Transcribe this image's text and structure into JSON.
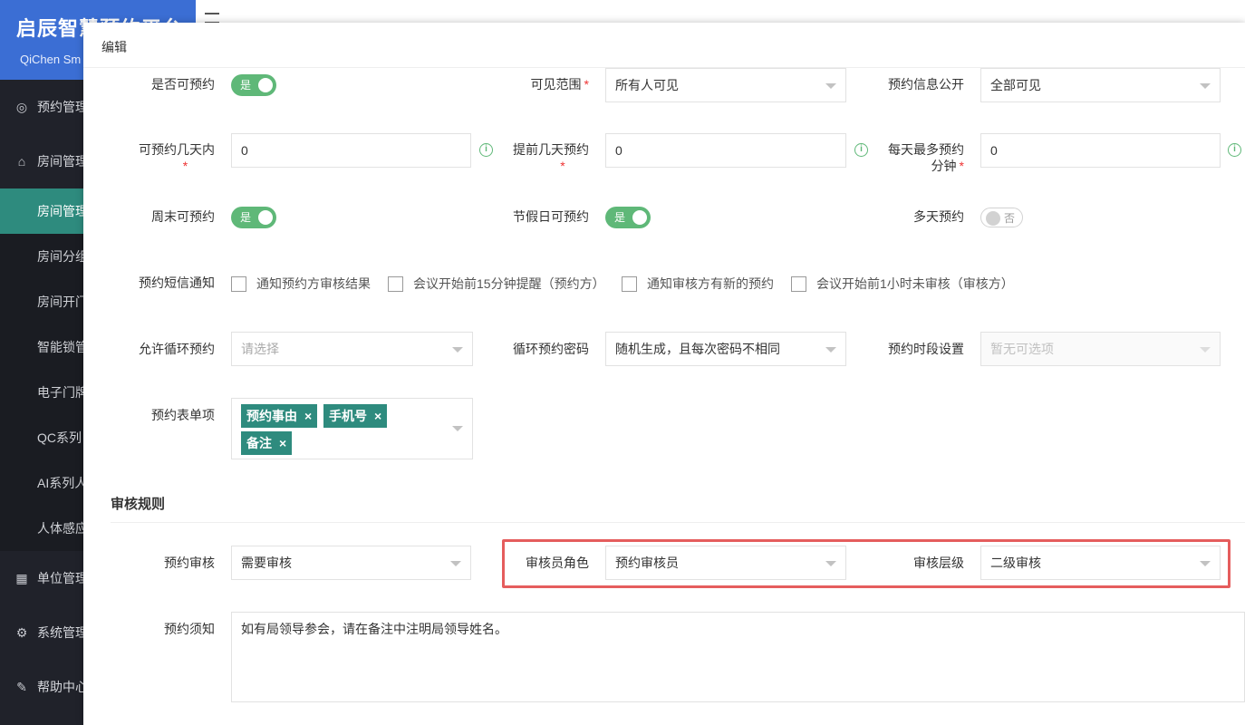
{
  "brand": {
    "title": "启辰智慧预约平台",
    "subtitle": "QiChen Sm"
  },
  "sidebar": {
    "groups": [
      {
        "label": "预约管理",
        "icon": "eye-icon"
      },
      {
        "label": "房间管理",
        "icon": "home-icon"
      },
      {
        "label": "单位管理",
        "icon": "building-icon"
      },
      {
        "label": "系统管理",
        "icon": "gear-icon"
      },
      {
        "label": "帮助中心",
        "icon": "help-doc-icon"
      }
    ],
    "room_items": [
      "房间管理",
      "房间分组",
      "房间开门",
      "智能锁管",
      "电子门牌",
      "QC系列",
      "AI系列人",
      "人体感应"
    ]
  },
  "modal": {
    "title": "编辑",
    "fields": {
      "bookable": {
        "label": "是否可预约",
        "value": "是"
      },
      "visible_range": {
        "label": "可见范围",
        "value": "所有人可见"
      },
      "info_public": {
        "label": "预约信息公开",
        "value": "全部可见"
      },
      "days_within": {
        "label": "可预约几天内",
        "value": "0"
      },
      "days_ahead": {
        "label": "提前几天预约",
        "value": "0"
      },
      "max_minutes": {
        "label_line1": "每天最多预约",
        "label_line2": "分钟",
        "value": "0"
      },
      "weekend": {
        "label": "周末可预约",
        "value": "是"
      },
      "holiday": {
        "label": "节假日可预约",
        "value": "是"
      },
      "multi_day": {
        "label": "多天预约",
        "value": "否"
      },
      "sms": {
        "label": "预约短信通知",
        "options": [
          "通知预约方审核结果",
          "会议开始前15分钟提醒（预约方）",
          "通知审核方有新的预约",
          "会议开始前1小时未审核（审核方）"
        ]
      },
      "recurring": {
        "label": "允许循环预约",
        "placeholder": "请选择"
      },
      "recurring_password": {
        "label": "循环预约密码",
        "value": "随机生成，且每次密码不相同"
      },
      "time_slot": {
        "label": "预约时段设置",
        "placeholder": "暂无可选项"
      },
      "form_items": {
        "label": "预约表单项",
        "tags": [
          "预约事由",
          "手机号",
          "备注"
        ]
      }
    },
    "review_section": {
      "title": "审核规则",
      "need_review": {
        "label": "预约审核",
        "value": "需要审核"
      },
      "reviewer_role": {
        "label": "审核员角色",
        "value": "预约审核员"
      },
      "review_level": {
        "label": "审核层级",
        "value": "二级审核"
      },
      "notice": {
        "label": "预约须知",
        "value": "如有局领导参会，请在备注中注明局领导姓名。"
      }
    }
  },
  "colors": {
    "accent": "#2e8b7e",
    "switch_on": "#5fb878",
    "highlight": "#e55d5d",
    "brand": "#3b6ed4"
  }
}
